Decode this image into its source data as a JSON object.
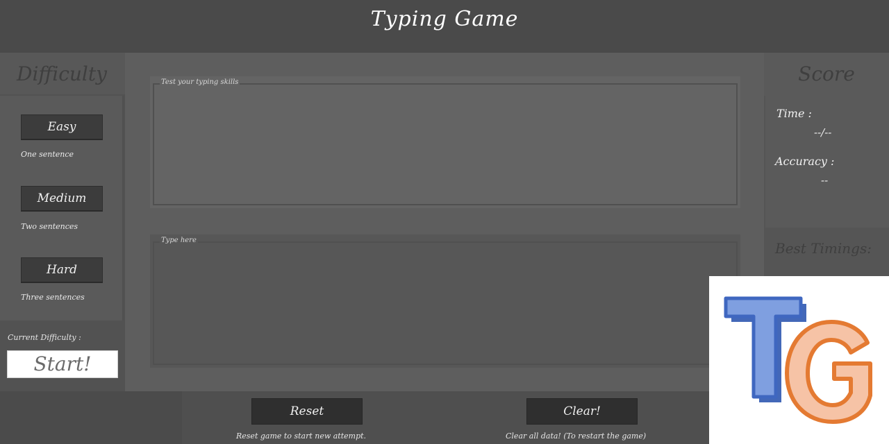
{
  "app": {
    "title": "Typing Game"
  },
  "difficulty": {
    "heading": "Difficulty",
    "levels": [
      {
        "label": "Easy",
        "description": "One sentence"
      },
      {
        "label": "Medium",
        "description": "Two sentences"
      },
      {
        "label": "Hard",
        "description": "Three sentences"
      }
    ],
    "current_label": "Current Difficulty :",
    "start_label": "Start!"
  },
  "main": {
    "prompt_legend": "Test your typing skills",
    "input_legend": "Type here"
  },
  "score": {
    "heading": "Score",
    "time_label": "Time :",
    "time_value": "--/--",
    "accuracy_label": "Accuracy :",
    "accuracy_value": "--",
    "best_timings_label": "Best Timings:"
  },
  "footer": {
    "reset_label": "Reset",
    "reset_hint": "Reset game to start new attempt.",
    "clear_label": "Clear!",
    "clear_hint": "Clear all data! (To restart the game)"
  },
  "logo": {
    "text": "TG",
    "t_color": "#4a72c8",
    "g_color": "#e8823a"
  }
}
